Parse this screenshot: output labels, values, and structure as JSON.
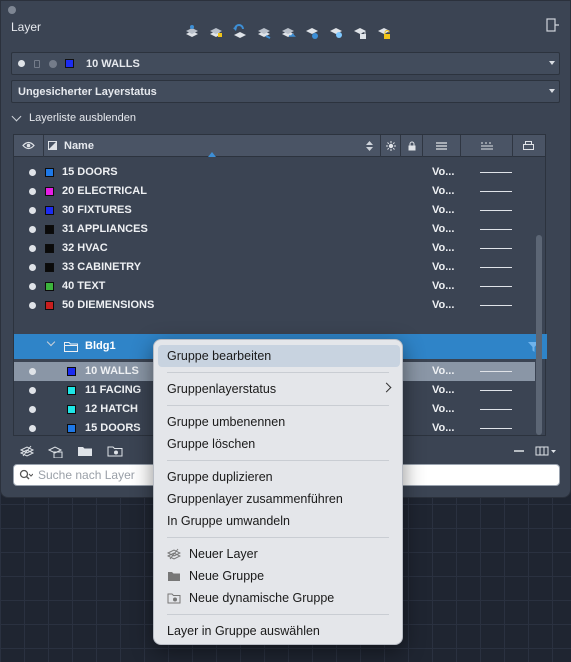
{
  "panel": {
    "title": "Layer"
  },
  "current_layer": {
    "name": "10 WALLS",
    "color": "#1c2cf0"
  },
  "layer_state": {
    "value": "Ungesicherter Layerstatus"
  },
  "toggle_list": {
    "label": "Layerliste ausblenden"
  },
  "table": {
    "name_header": "Name",
    "layers": [
      {
        "name": "15 DOORS",
        "color": "#1e78e6",
        "value": "Vo..."
      },
      {
        "name": "20 ELECTRICAL",
        "color": "#e61ee6",
        "value": "Vo..."
      },
      {
        "name": "30 FIXTURES",
        "color": "#1c2cf0",
        "value": "Vo..."
      },
      {
        "name": "31 APPLIANCES",
        "color": "#0a0a0a",
        "value": "Vo..."
      },
      {
        "name": "32 HVAC",
        "color": "#0a0a0a",
        "value": "Vo..."
      },
      {
        "name": "33 CABINETRY",
        "color": "#0a0a0a",
        "value": "Vo..."
      },
      {
        "name": "40 TEXT",
        "color": "#3cb43c",
        "value": "Vo..."
      },
      {
        "name": "50 DIEMENSIONS",
        "color": "#c81e1e",
        "value": "Vo..."
      }
    ],
    "group": {
      "name": "Bldg1",
      "color": "#2f84c8"
    },
    "group_layers": [
      {
        "name": "10 WALLS",
        "color": "#1c2cf0",
        "value": "Vo...",
        "selected": true
      },
      {
        "name": "11 FACING",
        "color": "#1ee6e6",
        "value": "Vo...",
        "selected": false
      },
      {
        "name": "12 HATCH",
        "color": "#1ee6e6",
        "value": "Vo...",
        "selected": false
      },
      {
        "name": "15 DOORS",
        "color": "#1e78e6",
        "value": "Vo...",
        "selected": false
      }
    ]
  },
  "search": {
    "placeholder": "Suche nach Layer"
  },
  "context_menu": {
    "items": [
      "Gruppe bearbeiten",
      "Gruppenlayerstatus",
      "Gruppe umbenennen",
      "Gruppe löschen",
      "Gruppe duplizieren",
      "Gruppenlayer zusammenführen",
      "In Gruppe umwandeln",
      "Neuer Layer",
      "Neue Gruppe",
      "Neue dynamische Gruppe",
      "Layer in Gruppe auswählen"
    ]
  }
}
